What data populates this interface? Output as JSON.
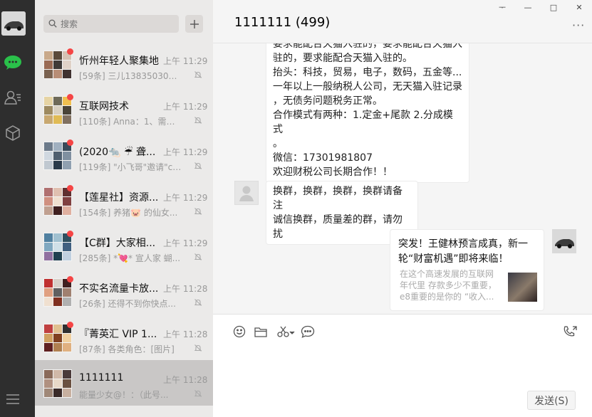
{
  "search": {
    "placeholder": "搜索"
  },
  "chat_list": [
    {
      "name": "忻州年轻人聚集地",
      "time": "上午 11:29",
      "preview": "[59条] 三儿1383503031...",
      "unread": true
    },
    {
      "name": "互联网技术",
      "time": "上午 11:29",
      "preview": "[110条] Anna：1、需注...",
      "unread": true
    },
    {
      "name": "(2020🐀 ☔ 聋...",
      "time": "上午 11:29",
      "preview": "[119条] \"小飞哥\"邀请\"ca...",
      "unread": true
    },
    {
      "name": "【莲星社】资源...",
      "time": "上午 11:29",
      "preview": "[154条] 养猪🐷 的仙女...",
      "unread": true
    },
    {
      "name": "【C群】大家相...",
      "time": "上午 11:29",
      "preview": "[285条] *💘* 宣人家 蝴...",
      "unread": true
    },
    {
      "name": "不实名流量卡放...",
      "time": "上午 11:28",
      "preview": "[26条] 还得不到你快点...",
      "unread": true
    },
    {
      "name": "『菁英汇 VIP 1...",
      "time": "上午 11:28",
      "preview": "[87条] 各类角色：[图片]",
      "unread": true
    },
    {
      "name": "1111111",
      "time": "上午 11:28",
      "preview": "能量少女@！：（此号...",
      "unread": false,
      "selected": true
    }
  ],
  "window": {
    "pin": "ᅮ",
    "minimize": "—",
    "maximize": "□",
    "close": "✕"
  },
  "chat": {
    "title": "1111111 (499)",
    "more": "···",
    "messages": [
      {
        "from": "other",
        "lines": [
          "要求能配合天猫入驻的，要求能配合天猫入",
          "驻的，要求能配合天猫入驻的。",
          "抬头：科技，贸易，电子，数码，五金等...",
          "一年以上一般纳税人公司，无天猫入驻记录",
          "，无债务问题税务正常。",
          "合作模式有两种：1.定金+尾款 2.分成模式",
          "。",
          "微信：17301981807",
          "欢迎财税公司长期合作！！"
        ]
      },
      {
        "from": "other",
        "lines": [
          "换群，换群，换群，换群请备注",
          "诚信换群，质量差的群，请勿扰"
        ]
      }
    ],
    "link_card": {
      "title": "突发！王健林预言成真，新一轮“财富机遇”即将来临！",
      "desc": "在这个高速发展的互联网年代里 存款多少不重要，e8重要的是你的 “收入..."
    }
  },
  "composer": {
    "send_label": "发送(S)"
  }
}
